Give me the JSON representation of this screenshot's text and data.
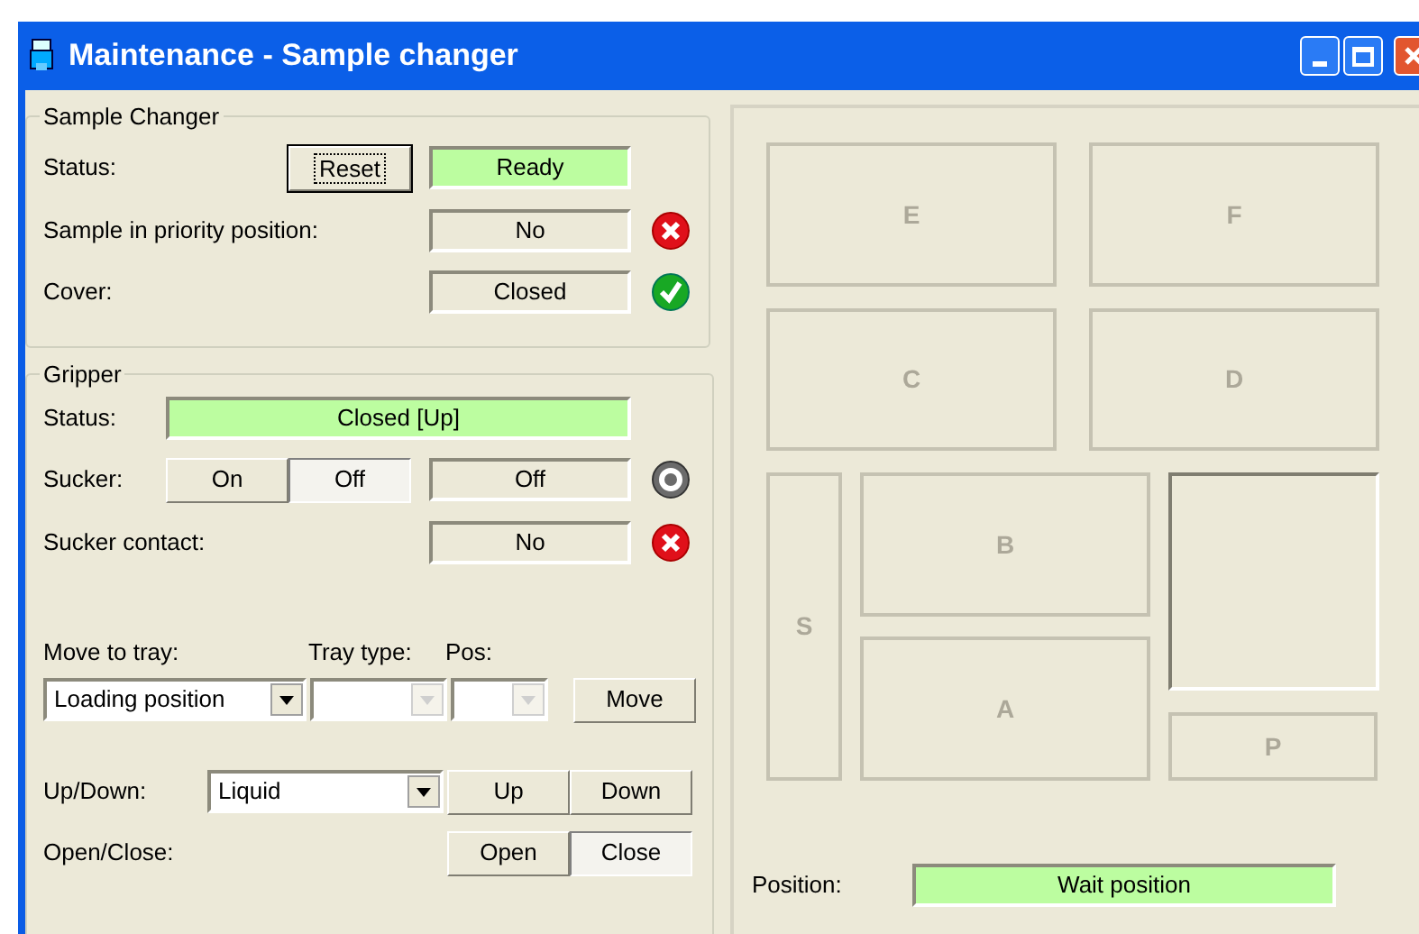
{
  "window": {
    "title": "Maintenance - Sample changer"
  },
  "sample_changer": {
    "title": "Sample Changer",
    "status": {
      "label": "Status:",
      "button": "Reset",
      "value": "Ready",
      "highlight": true
    },
    "priority": {
      "label": "Sample in priority position:",
      "value": "No",
      "kind": "error"
    },
    "cover": {
      "label": "Cover:",
      "value": "Closed",
      "kind": "ok"
    }
  },
  "gripper": {
    "title": "Gripper",
    "status": {
      "label": "Status:",
      "value": "Closed [Up]",
      "highlight": true
    },
    "sucker": {
      "label": "Sucker:",
      "buttons": [
        {
          "label": "On",
          "selected": false
        },
        {
          "label": "Off",
          "selected": true
        }
      ],
      "value": "Off",
      "kind": "idle"
    },
    "contact": {
      "label": "Sucker contact:",
      "value": "No",
      "kind": "error"
    },
    "move": {
      "label": "Move to tray:",
      "tray_type_label": "Tray type:",
      "pos_label": "Pos:",
      "tray": {
        "value": "Loading position",
        "disabled": false
      },
      "tray_type": {
        "disabled": true
      },
      "pos": {
        "disabled": true
      },
      "button": "Move"
    },
    "updown": {
      "label": "Up/Down:",
      "select": {
        "value": "Liquid",
        "disabled": false
      },
      "buttons": [
        {
          "label": "Up",
          "selected": false
        },
        {
          "label": "Down",
          "selected": false
        }
      ]
    },
    "openclose": {
      "label": "Open/Close:",
      "buttons": [
        {
          "label": "Open",
          "selected": false
        },
        {
          "label": "Close",
          "selected": true
        }
      ]
    }
  },
  "tray_map": {
    "slots": [
      {
        "label": "E",
        "kind": "slot"
      },
      {
        "label": "F",
        "kind": "slot"
      },
      {
        "label": "C",
        "kind": "slot"
      },
      {
        "label": "D",
        "kind": "slot"
      },
      {
        "label": "S",
        "kind": "slot"
      },
      {
        "label": "B",
        "kind": "slot"
      },
      {
        "label": "A",
        "kind": "slot"
      },
      {
        "kind": "sunken"
      },
      {
        "label": "P",
        "kind": "slot"
      }
    ],
    "position": {
      "label": "Position:",
      "value": "Wait position",
      "highlight": true
    }
  }
}
